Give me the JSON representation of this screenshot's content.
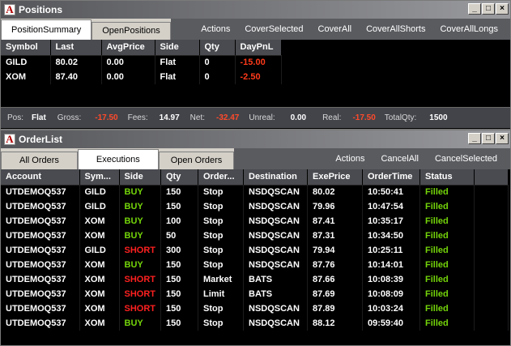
{
  "positions": {
    "title": "Positions",
    "tabs": [
      "PositionSummary",
      "OpenPositions"
    ],
    "actions": [
      "Actions",
      "CoverSelected",
      "CoverAll",
      "CoverAllShorts",
      "CoverAllLongs"
    ],
    "columns": [
      "Symbol",
      "Last",
      "AvgPrice",
      "Side",
      "Qty",
      "DayPnL"
    ],
    "rows": [
      [
        "GILD",
        "80.02",
        "0.00",
        "Flat",
        "0",
        "-15.00"
      ],
      [
        "XOM",
        "87.40",
        "0.00",
        "Flat",
        "0",
        "-2.50"
      ]
    ],
    "status": {
      "pos_label": "Pos:",
      "pos_value": "Flat",
      "gross_label": "Gross:",
      "gross_value": "-17.50",
      "fees_label": "Fees:",
      "fees_value": "14.97",
      "net_label": "Net:",
      "net_value": "-32.47",
      "unreal_label": "Unreal:",
      "unreal_value": "0.00",
      "real_label": "Real:",
      "real_value": "-17.50",
      "totalqty_label": "TotalQty:",
      "totalqty_value": "1500"
    }
  },
  "orders": {
    "title": "OrderList",
    "tabs": [
      "All Orders",
      "Executions",
      "Open Orders"
    ],
    "actions": [
      "Actions",
      "CancelAll",
      "CancelSelected"
    ],
    "columns": [
      "Account",
      "Sym...",
      "Side",
      "Qty",
      "Order...",
      "Destination",
      "ExePrice",
      "OrderTime",
      "Status"
    ],
    "rows": [
      [
        "UTDEMOQ537",
        "GILD",
        "BUY",
        "150",
        "Stop",
        "NSDQSCAN",
        "80.02",
        "10:50:41",
        "Filled"
      ],
      [
        "UTDEMOQ537",
        "GILD",
        "BUY",
        "150",
        "Stop",
        "NSDQSCAN",
        "79.96",
        "10:47:54",
        "Filled"
      ],
      [
        "UTDEMOQ537",
        "XOM",
        "BUY",
        "100",
        "Stop",
        "NSDQSCAN",
        "87.41",
        "10:35:17",
        "Filled"
      ],
      [
        "UTDEMOQ537",
        "XOM",
        "BUY",
        "50",
        "Stop",
        "NSDQSCAN",
        "87.31",
        "10:34:50",
        "Filled"
      ],
      [
        "UTDEMOQ537",
        "GILD",
        "SHORT",
        "300",
        "Stop",
        "NSDQSCAN",
        "79.94",
        "10:25:11",
        "Filled"
      ],
      [
        "UTDEMOQ537",
        "XOM",
        "BUY",
        "150",
        "Stop",
        "NSDQSCAN",
        "87.76",
        "10:14:01",
        "Filled"
      ],
      [
        "UTDEMOQ537",
        "XOM",
        "SHORT",
        "150",
        "Market",
        "BATS",
        "87.66",
        "10:08:39",
        "Filled"
      ],
      [
        "UTDEMOQ537",
        "XOM",
        "SHORT",
        "150",
        "Limit",
        "BATS",
        "87.69",
        "10:08:09",
        "Filled"
      ],
      [
        "UTDEMOQ537",
        "XOM",
        "SHORT",
        "150",
        "Stop",
        "NSDQSCAN",
        "87.89",
        "10:03:24",
        "Filled"
      ],
      [
        "UTDEMOQ537",
        "XOM",
        "BUY",
        "150",
        "Stop",
        "NSDQSCAN",
        "88.12",
        "09:59:40",
        "Filled"
      ]
    ]
  },
  "window_buttons": {
    "minimize": "_",
    "maximize": "□",
    "close": "×"
  },
  "icon": {
    "app_logo": "A"
  }
}
